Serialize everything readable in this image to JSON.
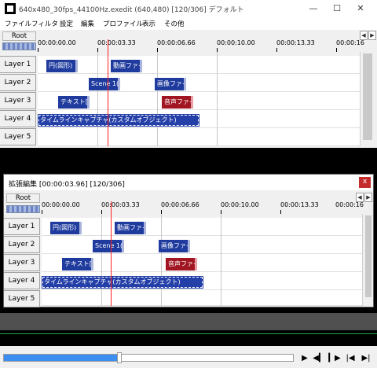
{
  "window": {
    "title": "640x480_30fps_44100Hz.exedit (640,480)  [120/306]  デフォルト",
    "minimize": "—",
    "maximize": "☐",
    "close": "✕"
  },
  "menu": [
    "ファイル",
    "フィルタ",
    "設定",
    "編集",
    "プロファイル",
    "表示",
    "その他"
  ],
  "timeline": {
    "root_label": "Root",
    "ticks": [
      "00:00:00.00",
      "00:00:03.33",
      "00:00:06.66",
      "00:00:10.00",
      "00:00:13.33",
      "00:00:16"
    ],
    "scroll_left": "◀",
    "scroll_right": "▶",
    "layers": [
      "Layer 1",
      "Layer 2",
      "Layer 3",
      "Layer 4",
      "Layer 5"
    ],
    "clips": {
      "circle": "円(図形)",
      "video": "動画ファイ",
      "scene": "Scene 1(",
      "image": "画像ファイ",
      "text": "テキスト[標",
      "audio": "音声ファイ",
      "capture": "タイムラインキャプチャ(カスタムオブジェクト)"
    }
  },
  "ext_window": {
    "title": "拡張編集 [00:00:03.96] [120/306]",
    "close": "x"
  },
  "playback": {
    "position_fraction": 0.39,
    "buttons": [
      "play-icon",
      "prev-frame-icon",
      "next-frame-icon",
      "to-start-icon",
      "to-end-icon"
    ],
    "glyphs": {
      "play": "▶",
      "prev_frame": "◀▎",
      "next_frame": "▎▶",
      "to_start": "|◀",
      "to_end": "▶|"
    }
  },
  "colors": {
    "clip_blue": "#1f3b9e",
    "clip_red": "#a11622",
    "playhead": "#ff2020",
    "seek_fill": "#3c8ef0",
    "close_button": "#c42b2b"
  }
}
